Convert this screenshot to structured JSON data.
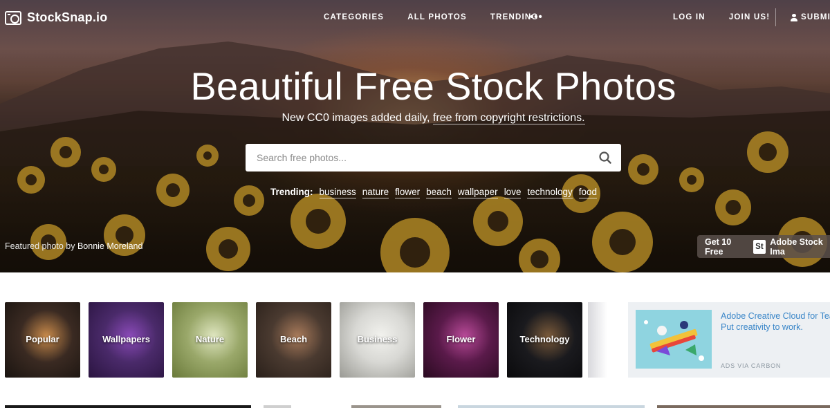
{
  "brand": {
    "name": "StockSnap.io",
    "icon": "camera-icon"
  },
  "nav": {
    "links": [
      "CATEGORIES",
      "ALL PHOTOS",
      "TRENDING"
    ],
    "more": "•••",
    "login": "LOG IN",
    "join": "JOIN US!",
    "submit": "SUBMIT",
    "submit_icon": "user-icon"
  },
  "hero": {
    "title": "Beautiful Free Stock Photos",
    "subtitle_prefix": "New CC0 images added daily, ",
    "subtitle_link": "free from copyright restrictions.",
    "search_placeholder": "Search free photos...",
    "search_icon": "search-icon",
    "trending_label": "Trending:",
    "trending_tags": [
      "business",
      "nature",
      "flower",
      "beach",
      "wallpaper",
      "love",
      "technology",
      "food"
    ],
    "featured_prefix": "Featured photo by",
    "featured_author": "Bonnie Moreland",
    "adobe_prefix": "Get 10 Free",
    "adobe_badge": "St",
    "adobe_suffix": "Adobe Stock Ima"
  },
  "categories": [
    {
      "label": "Popular",
      "colors": [
        "#3a2a22",
        "#c88a4a",
        "#1a1410"
      ]
    },
    {
      "label": "Wallpapers",
      "colors": [
        "#4a2a6a",
        "#8a4ab8",
        "#2a1440"
      ]
    },
    {
      "label": "Nature",
      "colors": [
        "#9aa86a",
        "#dfe6c0",
        "#6a7a3a"
      ]
    },
    {
      "label": "Beach",
      "colors": [
        "#4a3a30",
        "#a87a5a",
        "#2a201a"
      ]
    },
    {
      "label": "Business",
      "colors": [
        "#d8d8d4",
        "#f2f2ee",
        "#9a9a94"
      ]
    },
    {
      "label": "Flower",
      "colors": [
        "#5a1a4a",
        "#b84a98",
        "#2a0a20"
      ]
    },
    {
      "label": "Technology",
      "colors": [
        "#1a1a1e",
        "#7a5a3a",
        "#0a0a0c"
      ]
    }
  ],
  "ad": {
    "line1": "Adobe Creative Cloud for Tea",
    "line2": "Put creativity to work.",
    "footer": "ADS VIA CARBON"
  },
  "colors": {
    "link_blue": "#3a86c8",
    "ad_bg": "#edf0f3"
  }
}
